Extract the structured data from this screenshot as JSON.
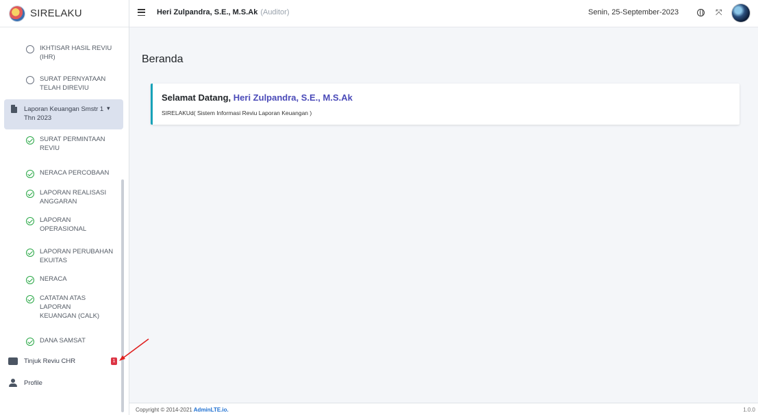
{
  "brand": {
    "name": "SIRELAKU"
  },
  "header": {
    "user_name": "Heri Zulpandra, S.E., M.S.Ak",
    "user_role": "(Auditor)",
    "date": "Senin, 25-September-2023"
  },
  "sidebar": {
    "items_top": [
      {
        "label": "IKHTISAR HASIL REVIU (IHR)",
        "icon": "circle-icon"
      },
      {
        "label": "SURAT PERNYATAAN TELAH DIREVIU",
        "icon": "circle-icon"
      }
    ],
    "parent": {
      "label": "Laporan Keuangan Smstr 1 Thn 2023",
      "icon": "file-icon"
    },
    "items_sub": [
      {
        "label": "SURAT PERMINTAAN REVIU",
        "icon": "check-circle-icon"
      },
      {
        "label": "NERACA PERCOBAAN",
        "icon": "check-circle-icon"
      },
      {
        "label": "LAPORAN REALISASI ANGGARAN",
        "icon": "check-circle-icon"
      },
      {
        "label": "LAPORAN OPERASIONAL",
        "icon": "check-circle-icon"
      },
      {
        "label": "LAPORAN PERUBAHAN EKUITAS",
        "icon": "check-circle-icon"
      },
      {
        "label": "NERACA",
        "icon": "check-circle-icon"
      },
      {
        "label": "CATATAN ATAS LAPORAN KEUANGAN (CaLK)",
        "icon": "check-circle-icon"
      },
      {
        "label": "DANA SAMSAT",
        "icon": "check-circle-icon"
      }
    ],
    "tinjuk": {
      "label": "Tinjuk Reviu CHR",
      "badge": "1"
    },
    "profile": {
      "label": "Profile"
    }
  },
  "main": {
    "title": "Beranda",
    "welcome": {
      "greeting": "Selamat Datang,",
      "name": "Heri Zulpandra, S.E., M.S.Ak",
      "subtitle": "SIRELAKUd( Sistem Informasi Reviu Laporan Keuangan )"
    }
  },
  "footer": {
    "copyright": "Copyright © 2014-2021",
    "link": "AdminLTE.io.",
    "version": "1.0.0"
  },
  "colors": {
    "accent_border": "#17a2b8",
    "check_green": "#28a745",
    "badge_red": "#dc3545",
    "name_color": "#4a4ab8"
  }
}
